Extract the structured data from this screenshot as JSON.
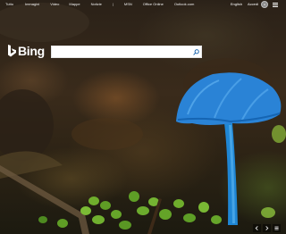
{
  "nav": {
    "items": [
      "Tutto",
      "Immagini",
      "Video",
      "Mappe",
      "Notizie",
      "|",
      "MSN",
      "Office Online",
      "Outlook.com"
    ]
  },
  "header_right": {
    "language": "English",
    "signin": "Accedi",
    "avatar_initial": "A"
  },
  "brand": {
    "name": "Bing",
    "logo_color": "#ffffff"
  },
  "search": {
    "value": "",
    "placeholder": "",
    "icon": "search-icon",
    "icon_color": "#0f5da8"
  },
  "controls": {
    "icons": [
      "chevron-left-icon",
      "chevron-right-icon",
      "menu-icon"
    ]
  },
  "colors": {
    "mushroom_cap": "#2a83d6",
    "mushroom_stem": "#1f86d4",
    "clover": "#6aa72c"
  }
}
